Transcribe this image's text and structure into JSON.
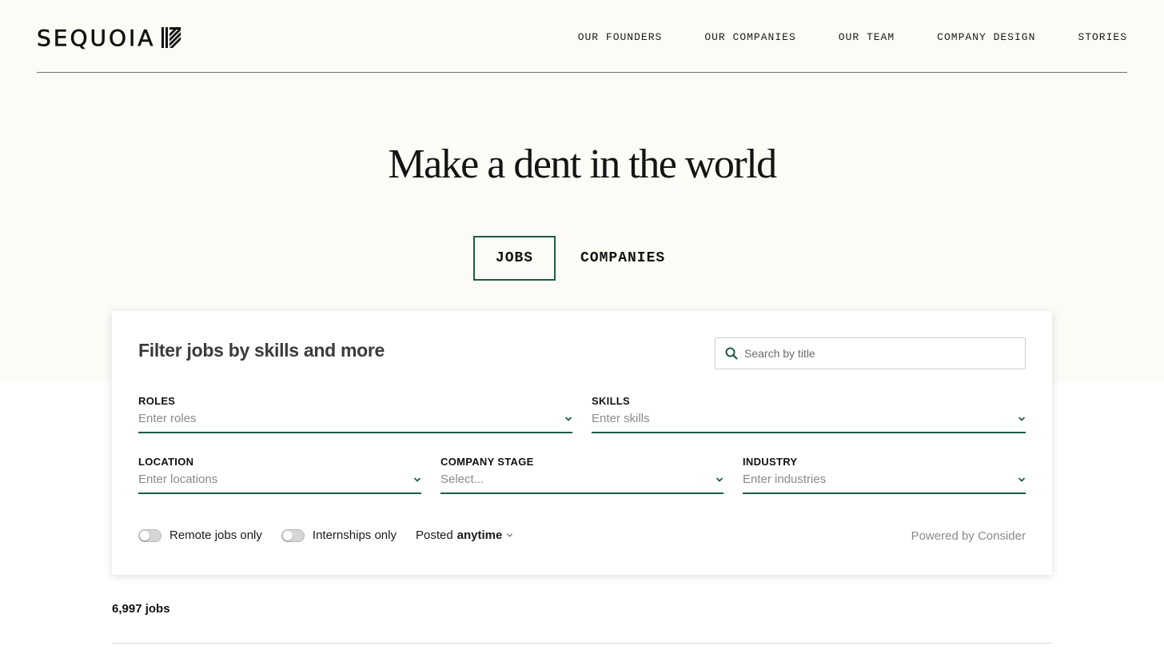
{
  "brand": {
    "name": "SEQUOIA"
  },
  "nav": {
    "items": [
      "OUR FOUNDERS",
      "OUR COMPANIES",
      "OUR TEAM",
      "COMPANY DESIGN",
      "STORIES"
    ]
  },
  "hero": {
    "title": "Make a dent in the world"
  },
  "tabs": [
    {
      "label": "JOBS",
      "active": true
    },
    {
      "label": "COMPANIES",
      "active": false
    }
  ],
  "filters": {
    "title": "Filter jobs by skills and more",
    "search_placeholder": "Search by title",
    "roles": {
      "label": "ROLES",
      "placeholder": "Enter roles"
    },
    "skills": {
      "label": "SKILLS",
      "placeholder": "Enter skills"
    },
    "location": {
      "label": "LOCATION",
      "placeholder": "Enter locations"
    },
    "company_stage": {
      "label": "COMPANY STAGE",
      "placeholder": "Select..."
    },
    "industry": {
      "label": "INDUSTRY",
      "placeholder": "Enter industries"
    },
    "remote_toggle": "Remote jobs only",
    "internship_toggle": "Internships only",
    "posted_prefix": "Posted",
    "posted_value": "anytime",
    "powered_by": "Powered by Consider"
  },
  "results": {
    "count": "6,997 jobs"
  },
  "colors": {
    "accent": "#1f5c44",
    "hero_bg": "#fcfbf6"
  }
}
